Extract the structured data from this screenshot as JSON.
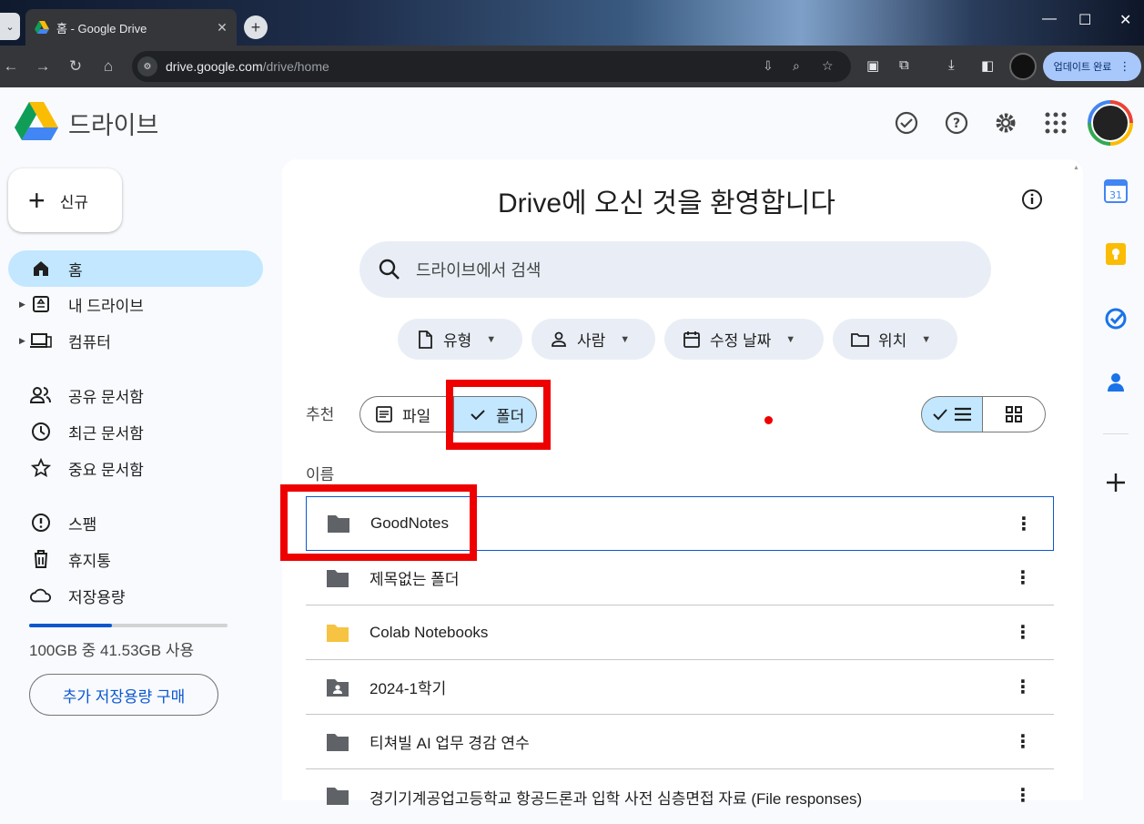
{
  "browser": {
    "tab_title": "홈 - Google Drive",
    "url_host": "drive.google.com",
    "url_path": "/drive/home",
    "update_label": "업데이트 완료"
  },
  "header": {
    "brand": "드라이브"
  },
  "sidebar": {
    "new_label": "신규",
    "items": [
      {
        "label": "홈",
        "icon": "home-icon"
      },
      {
        "label": "내 드라이브",
        "icon": "my-drive-icon"
      },
      {
        "label": "컴퓨터",
        "icon": "computers-icon"
      },
      {
        "label": "공유 문서함",
        "icon": "shared-icon"
      },
      {
        "label": "최근 문서함",
        "icon": "clock-icon"
      },
      {
        "label": "중요 문서함",
        "icon": "star-icon"
      },
      {
        "label": "스팸",
        "icon": "spam-icon"
      },
      {
        "label": "휴지통",
        "icon": "trash-icon"
      },
      {
        "label": "저장용량",
        "icon": "cloud-icon"
      }
    ],
    "storage_text": "100GB 중 41.53GB 사용",
    "storage_fraction": 0.4153,
    "buy_label": "추가 저장용량 구매"
  },
  "main": {
    "welcome_title": "Drive에 오신 것을 환영합니다",
    "search_placeholder": "드라이브에서 검색",
    "filters": [
      {
        "label": "유형",
        "icon": "file-icon"
      },
      {
        "label": "사람",
        "icon": "person-icon"
      },
      {
        "label": "수정 날짜",
        "icon": "calendar-icon"
      },
      {
        "label": "위치",
        "icon": "folder-outline-icon"
      }
    ],
    "recommended_label": "추천",
    "segment_files": "파일",
    "segment_folders": "폴더",
    "column_name": "이름",
    "rows": [
      {
        "name": "GoodNotes",
        "icon": "folder-icon",
        "color": "#5f6368"
      },
      {
        "name": "제목없는 폴더",
        "icon": "folder-icon",
        "color": "#5f6368"
      },
      {
        "name": "Colab Notebooks",
        "icon": "folder-icon",
        "color": "#f6c342"
      },
      {
        "name": "2024-1학기",
        "icon": "shared-folder-icon",
        "color": "#5f6368"
      },
      {
        "name": "티쳐빌 AI 업무 경감 연수",
        "icon": "folder-icon",
        "color": "#5f6368"
      },
      {
        "name": "경기기계공업고등학교 항공드론과 입학 사전 심층면접 자료 (File responses)",
        "icon": "folder-icon",
        "color": "#5f6368"
      }
    ]
  },
  "side_panel": [
    "calendar-icon",
    "keep-icon",
    "tasks-icon",
    "contacts-icon",
    "add-icon"
  ],
  "colors": {
    "accent": "#0b57d0",
    "selected_bg": "#c2e7ff",
    "highlight": "#ee0000"
  }
}
